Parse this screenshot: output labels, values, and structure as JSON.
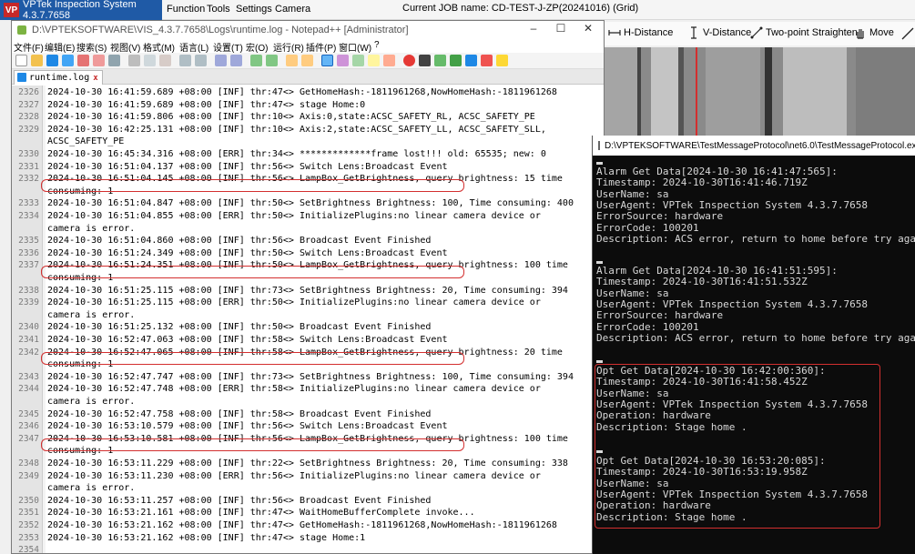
{
  "vptek": {
    "brand": "VPTek Inspection System 4.3.7.7658",
    "menus": [
      "Function",
      "Tools",
      "Settings",
      "Camera"
    ],
    "job": "Current JOB name:  CD-TEST-J-ZP(20241016) (Grid)",
    "tools": [
      "H-Distance",
      "V-Distance",
      "Two-point Straighten",
      "Move"
    ]
  },
  "notepad": {
    "title": "D:\\VPTEKSOFTWARE\\VIS_4.3.7.7658\\Logs\\runtime.log - Notepad++ [Administrator]",
    "menus": [
      "文件(F)",
      "编辑(E)",
      "搜索(S)",
      "视图(V)",
      "格式(M)",
      "语言(L)",
      "设置(T)",
      "宏(O)",
      "运行(R)",
      "插件(P)",
      "窗口(W)",
      "?"
    ],
    "tab": "runtime.log",
    "tab_close": "x",
    "lines": [
      {
        "n": "2326",
        "t": "2024-10-30 16:41:59.689 +08:00 [INF] thr:47<> GetHomeHash:-1811961268,NowHomeHash:-1811961268"
      },
      {
        "n": "2327",
        "t": "2024-10-30 16:41:59.689 +08:00 [INF] thr:47<> stage Home:0"
      },
      {
        "n": "2328",
        "t": "2024-10-30 16:41:59.806 +08:00 [INF] thr:10<> Axis:0,state:ACSC_SAFETY_RL, ACSC_SAFETY_PE"
      },
      {
        "n": "2329",
        "t": "2024-10-30 16:42:25.131 +08:00 [INF] thr:10<> Axis:2,state:ACSC_SAFETY_LL, ACSC_SAFETY_SLL,"
      },
      {
        "n": "",
        "t": "ACSC_SAFETY_PE"
      },
      {
        "n": "2330",
        "t": "2024-10-30 16:45:34.316 +08:00 [ERR] thr:34<> *************frame lost!!! old: 65535; new: 0"
      },
      {
        "n": "2331",
        "t": "2024-10-30 16:51:04.137 +08:00 [INF] thr:56<> Switch Lens:Broadcast Event"
      },
      {
        "n": "2332",
        "t": "2024-10-30 16:51:04.145 +08:00 [INF] thr:56<> LampBox_GetBrightness, query brightness: 15 time"
      },
      {
        "n": "",
        "t": "consuming: 1"
      },
      {
        "n": "2333",
        "t": "2024-10-30 16:51:04.847 +08:00 [INF] thr:50<> SetBrightness Brightness: 100, Time consuming: 400"
      },
      {
        "n": "2334",
        "t": "2024-10-30 16:51:04.855 +08:00 [ERR] thr:50<> InitializePlugins:no linear camera device or"
      },
      {
        "n": "",
        "t": "camera is error."
      },
      {
        "n": "2335",
        "t": "2024-10-30 16:51:04.860 +08:00 [INF] thr:56<> Broadcast Event Finished"
      },
      {
        "n": "2336",
        "t": "2024-10-30 16:51:24.349 +08:00 [INF] thr:50<> Switch Lens:Broadcast Event"
      },
      {
        "n": "2337",
        "t": "2024-10-30 16:51:24.351 +08:00 [INF] thr:50<> LampBox_GetBrightness, query brightness: 100 time"
      },
      {
        "n": "",
        "t": "consuming: 1"
      },
      {
        "n": "2338",
        "t": "2024-10-30 16:51:25.115 +08:00 [INF] thr:73<> SetBrightness Brightness: 20, Time consuming: 394"
      },
      {
        "n": "2339",
        "t": "2024-10-30 16:51:25.115 +08:00 [ERR] thr:50<> InitializePlugins:no linear camera device or"
      },
      {
        "n": "",
        "t": "camera is error."
      },
      {
        "n": "2340",
        "t": "2024-10-30 16:51:25.132 +08:00 [INF] thr:50<> Broadcast Event Finished"
      },
      {
        "n": "2341",
        "t": "2024-10-30 16:52:47.063 +08:00 [INF] thr:58<> Switch Lens:Broadcast Event"
      },
      {
        "n": "2342",
        "t": "2024-10-30 16:52:47.065 +08:00 [INF] thr:58<> LampBox_GetBrightness, query brightness: 20 time"
      },
      {
        "n": "",
        "t": "consuming: 1"
      },
      {
        "n": "2343",
        "t": "2024-10-30 16:52:47.747 +08:00 [INF] thr:73<> SetBrightness Brightness: 100, Time consuming: 394"
      },
      {
        "n": "2344",
        "t": "2024-10-30 16:52:47.748 +08:00 [ERR] thr:58<> InitializePlugins:no linear camera device or"
      },
      {
        "n": "",
        "t": "camera is error."
      },
      {
        "n": "2345",
        "t": "2024-10-30 16:52:47.758 +08:00 [INF] thr:58<> Broadcast Event Finished"
      },
      {
        "n": "2346",
        "t": "2024-10-30 16:53:10.579 +08:00 [INF] thr:56<> Switch Lens:Broadcast Event"
      },
      {
        "n": "2347",
        "t": "2024-10-30 16:53:10.581 +08:00 [INF] thr:56<> LampBox_GetBrightness, query brightness: 100 time"
      },
      {
        "n": "",
        "t": "consuming: 1"
      },
      {
        "n": "2348",
        "t": "2024-10-30 16:53:11.229 +08:00 [INF] thr:22<> SetBrightness Brightness: 20, Time consuming: 338"
      },
      {
        "n": "2349",
        "t": "2024-10-30 16:53:11.230 +08:00 [ERR] thr:56<> InitializePlugins:no linear camera device or"
      },
      {
        "n": "",
        "t": "camera is error."
      },
      {
        "n": "2350",
        "t": "2024-10-30 16:53:11.257 +08:00 [INF] thr:56<> Broadcast Event Finished"
      },
      {
        "n": "2351",
        "t": "2024-10-30 16:53:21.161 +08:00 [INF] thr:47<> WaitHomeBufferComplete invoke..."
      },
      {
        "n": "2352",
        "t": "2024-10-30 16:53:21.162 +08:00 [INF] thr:47<> GetHomeHash:-1811961268,NowHomeHash:-1811961268"
      },
      {
        "n": "2353",
        "t": "2024-10-30 16:53:21.162 +08:00 [INF] thr:47<> stage Home:1"
      },
      {
        "n": "2354",
        "t": ""
      }
    ]
  },
  "console": {
    "title": "D:\\VPTEKSOFTWARE\\TestMessageProtocol\\net6.0\\TestMessageProtocol.exe",
    "lines": [
      "Alarm Get Data[2024-10-30 16:41:47:565]:",
      "Timestamp: 2024-10-30T16:41:46.719Z",
      "UserName: sa",
      "UserAgent: VPTek Inspection System 4.3.7.7658",
      "ErrorSource: hardware",
      "ErrorCode: 100201",
      "Description: ACS error, return to home before try again",
      "Alarm Get Data[2024-10-30 16:41:51:595]:",
      "Timestamp: 2024-10-30T16:41:51.532Z",
      "UserName: sa",
      "UserAgent: VPTek Inspection System 4.3.7.7658",
      "ErrorSource: hardware",
      "ErrorCode: 100201",
      "Description: ACS error, return to home before try again",
      "Opt Get Data[2024-10-30 16:42:00:360]:",
      "Timestamp: 2024-10-30T16:41:58.452Z",
      "UserName: sa",
      "UserAgent: VPTek Inspection System 4.3.7.7658",
      "Operation: hardware",
      "Description: Stage home .",
      "Opt Get Data[2024-10-30 16:53:20:085]:",
      "Timestamp: 2024-10-30T16:53:19.958Z",
      "UserName: sa",
      "UserAgent: VPTek Inspection System 4.3.7.7658",
      "Operation: hardware",
      "Description: Stage home ."
    ]
  },
  "colors": {
    "highlight": "#d32f2f",
    "console_bg": "#0c0c0c",
    "vptek_brand": "#1f5aa6"
  }
}
